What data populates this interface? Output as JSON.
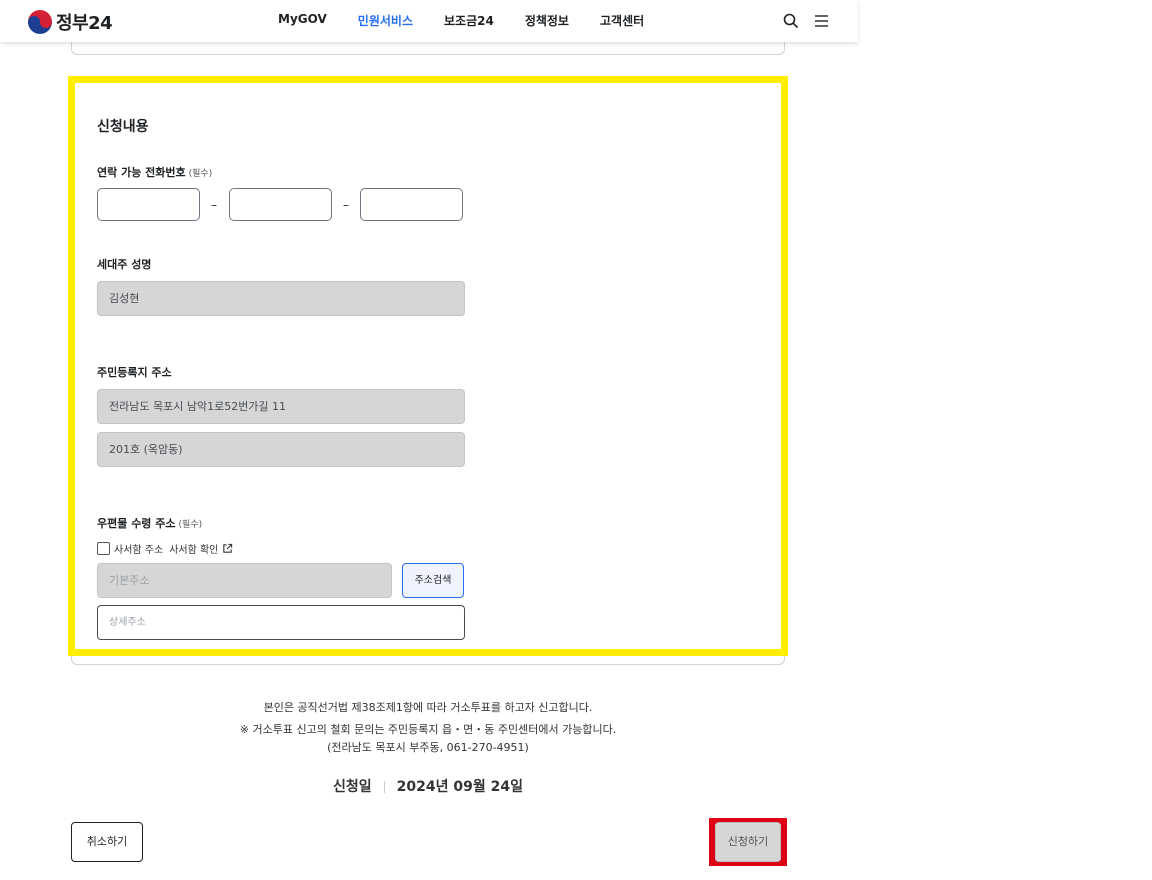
{
  "header": {
    "logo_text": "정부24",
    "nav": [
      "MyGOV",
      "민원서비스",
      "보조금24",
      "정책정보",
      "고객센터"
    ],
    "active_nav": "민원서비스"
  },
  "form": {
    "section_title": "신청내용",
    "phone_label": "연락 가능 전화번호",
    "required_mark": "(필수)",
    "phone_dash": "–",
    "householder_label": "세대주 성명",
    "householder_value": "김성현",
    "resident_address_label": "주민등록지 주소",
    "resident_address_line1": "전라남도 목포시 남악1로52번가길 11",
    "resident_address_line2": "201호 (옥암동)",
    "mail_address_label": "우편물 수령 주소",
    "same_address_checkbox": "사서함 주소",
    "po_box_check_link": "사서함 확인",
    "base_address_placeholder": "기본주소",
    "address_search_button": "주소검색",
    "detail_address_placeholder": "상세주소"
  },
  "notice": {
    "line1": "본인은 공직선거법 제38조제1항에 따라 거소투표를 하고자 신고합니다.",
    "line2": "※ 거소투표 신고의 철회 문의는 주민등록지 읍・면・동 주민센터에서 가능합니다.",
    "line3": "(전라남도 목포시 부주동, 061-270-4951)"
  },
  "apply_date": {
    "label": "신청일",
    "value": "2024년 09월 24일"
  },
  "buttons": {
    "cancel": "취소하기",
    "submit": "신청하기"
  },
  "colors": {
    "highlight_yellow": "#ffee00",
    "highlight_red": "#e00016",
    "accent_blue": "#256ef4"
  }
}
